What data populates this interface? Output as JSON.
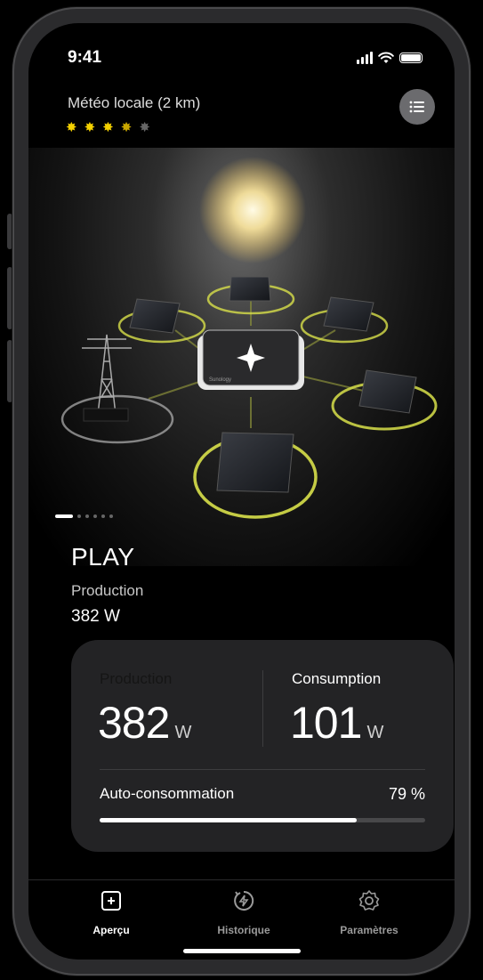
{
  "status_bar": {
    "time": "9:41"
  },
  "weather": {
    "title": "Météo locale (2 km)",
    "rating": 3.5,
    "max": 5,
    "stars": [
      "✸",
      "✸",
      "✸",
      "✸",
      "✸"
    ]
  },
  "carousel": {
    "pages": 6,
    "current": 1
  },
  "device": {
    "name": "PLAY",
    "production_label": "Production",
    "production_value": "382 W",
    "hub_label": "Sunology"
  },
  "stats": {
    "production_label": "Production",
    "production_value": "382",
    "production_unit": "W",
    "consumption_label": "Consumption",
    "consumption_value": "101",
    "consumption_unit": "W",
    "self_consumption_label": "Auto-consommation",
    "self_consumption_value": "79 %",
    "self_consumption_fraction": 0.79
  },
  "tabs": [
    {
      "label": "Aperçu",
      "icon": "plus-square-icon"
    },
    {
      "label": "Historique",
      "icon": "bolt-circle-icon"
    },
    {
      "label": "Paramètres",
      "icon": "gear-icon"
    }
  ],
  "colors": {
    "accent_yellow": "#f4d100",
    "ring_yellow": "#d8e04a",
    "card": "#232325"
  }
}
